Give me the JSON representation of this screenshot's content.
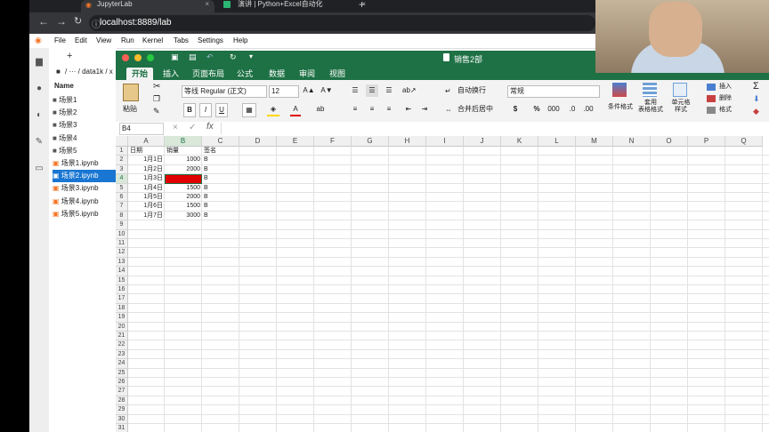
{
  "browser": {
    "tabs": [
      {
        "title": "JupyterLab",
        "active": true
      },
      {
        "title": "演讲 | Python+Excel自动化",
        "active": false
      }
    ],
    "url": "localhost:8889/lab"
  },
  "jupyter": {
    "menu": [
      "File",
      "Edit",
      "View",
      "Run",
      "Kernel",
      "Tabs",
      "Settings",
      "Help"
    ],
    "path": "/ ··· / data1k / x",
    "name_header": "Name",
    "files": [
      "场景1",
      "场景2",
      "场景3",
      "场景4",
      "场景5",
      "场景1.ipynb",
      "场景2.ipynb",
      "场景3.ipynb",
      "场景4.ipynb",
      "场景5.ipynb"
    ],
    "selected_file": "场景2.ipynb"
  },
  "excel": {
    "title": "销售2部",
    "tabs": [
      "开始",
      "插入",
      "页面布局",
      "公式",
      "数据",
      "审阅",
      "视图"
    ],
    "active_tab": "开始",
    "ribbon": {
      "paste": "粘贴",
      "font_name": "等线 Regular (正文)",
      "font_size": "12",
      "wrap_text": "自动换行",
      "merge_center": "合并后居中",
      "number_format": "常规",
      "conditional_format": "条件格式",
      "table_format": "套用\n表格格式",
      "cell_style": "单元格\n样式",
      "insert": "插入",
      "delete": "删除",
      "format": "格式",
      "bold": "B",
      "italic": "I",
      "underline": "U",
      "currency": "$",
      "percent": "%",
      "thousands": "000"
    },
    "name_box": "B4",
    "formula": "",
    "columns": [
      "A",
      "B",
      "C",
      "D",
      "E",
      "F",
      "G",
      "H",
      "I",
      "J",
      "K",
      "L",
      "M",
      "N",
      "O",
      "P",
      "Q"
    ],
    "row_numbers": [
      "1",
      "2",
      "3",
      "4",
      "5",
      "6",
      "7",
      "8",
      "9",
      "10",
      "11",
      "12",
      "13",
      "14",
      "15",
      "16",
      "17",
      "18",
      "19",
      "20",
      "21",
      "22",
      "23",
      "24",
      "25",
      "26",
      "27",
      "28",
      "29",
      "30",
      "31"
    ],
    "rows": [
      [
        "日期",
        "销量",
        "签名"
      ],
      [
        "1月1日",
        "1000",
        "B"
      ],
      [
        "1月2日",
        "2000",
        "B"
      ],
      [
        "1月3日",
        "",
        "B"
      ],
      [
        "1月4日",
        "1500",
        "B"
      ],
      [
        "1月5日",
        "2000",
        "B"
      ],
      [
        "1月6日",
        "1500",
        "B"
      ],
      [
        "1月7日",
        "3000",
        "B"
      ]
    ],
    "highlight_color": "#e00000",
    "accent": "#1e7145"
  }
}
